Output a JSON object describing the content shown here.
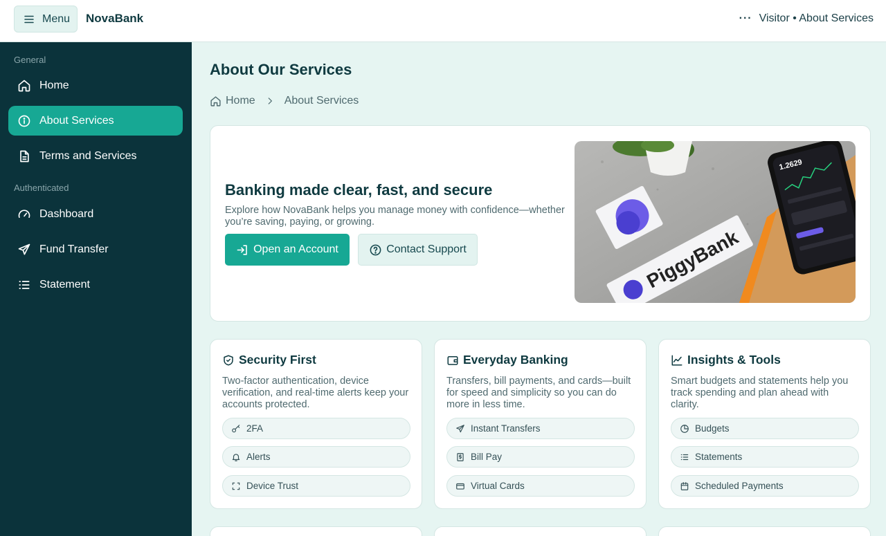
{
  "topbar": {
    "menu_label": "Menu",
    "brand": "NovaBank",
    "more_icon": "more-dots-icon",
    "user_status": "Visitor • About Services"
  },
  "sidebar": {
    "sections": [
      {
        "label": "General",
        "items": [
          {
            "label": "Home",
            "icon": "home-icon",
            "active": false
          },
          {
            "label": "About Services",
            "icon": "info-icon",
            "active": true
          },
          {
            "label": "Terms and Services",
            "icon": "document-icon",
            "active": false
          }
        ]
      },
      {
        "label": "Authenticated",
        "items": [
          {
            "label": "Dashboard",
            "icon": "gauge-icon",
            "active": false
          },
          {
            "label": "Fund Transfer",
            "icon": "send-icon",
            "active": false
          },
          {
            "label": "Statement",
            "icon": "list-icon",
            "active": false
          }
        ]
      }
    ]
  },
  "main": {
    "title": "About Our Services",
    "breadcrumb": {
      "home": "Home",
      "current": "About Services"
    },
    "hero": {
      "title": "Banking made clear, fast, and secure",
      "text": "Explore how NovaBank helps you manage money with confidence—whether you’re saving, paying, or growing.",
      "primary_button": "Open an Account",
      "secondary_button": "Contact Support",
      "image_text": "PiggyBank",
      "image_phone_value": "1.2629"
    },
    "cards": [
      {
        "title": "Security First",
        "icon": "shield-check-icon",
        "text": "Two-factor authentication, device verification, and real-time alerts keep your accounts protected.",
        "chips": [
          {
            "label": "2FA",
            "icon": "key-icon"
          },
          {
            "label": "Alerts",
            "icon": "bell-icon"
          },
          {
            "label": "Device Trust",
            "icon": "scan-icon"
          }
        ]
      },
      {
        "title": "Everyday Banking",
        "icon": "wallet-icon",
        "text": "Transfers, bill payments, and cards—built for speed and simplicity so you can do more in less time.",
        "chips": [
          {
            "label": "Instant Transfers",
            "icon": "send-icon"
          },
          {
            "label": "Bill Pay",
            "icon": "bill-icon"
          },
          {
            "label": "Virtual Cards",
            "icon": "card-icon"
          }
        ]
      },
      {
        "title": "Insights & Tools",
        "icon": "chart-line-icon",
        "text": "Smart budgets and statements help you track spending and plan ahead with clarity.",
        "chips": [
          {
            "label": "Budgets",
            "icon": "pie-icon"
          },
          {
            "label": "Statements",
            "icon": "list-icon"
          },
          {
            "label": "Scheduled Payments",
            "icon": "calendar-icon"
          }
        ]
      }
    ]
  },
  "colors": {
    "accent": "#17a894",
    "sidebar_bg": "#0b333b",
    "page_bg": "#e6f5f2"
  }
}
